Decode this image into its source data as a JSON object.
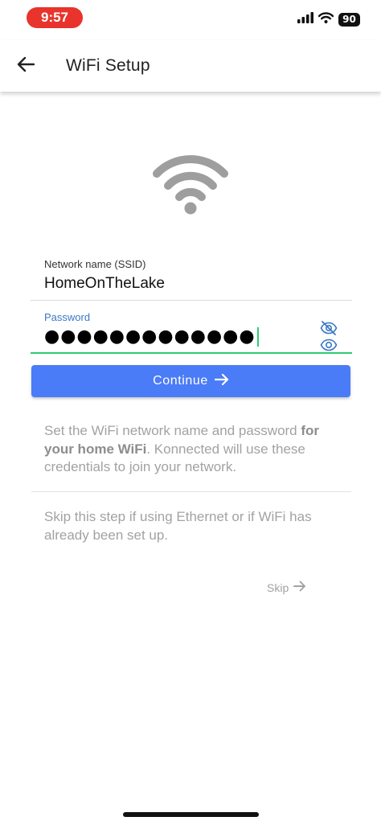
{
  "status_bar": {
    "time": "9:57",
    "battery": "90",
    "icons": [
      "cellular-signal-icon",
      "wifi-status-icon",
      "battery-icon"
    ],
    "time_pill_color": "#e8342c"
  },
  "app_bar": {
    "title": "WiFi Setup",
    "back_icon": "arrow-left-icon"
  },
  "hero_icon": "wifi-icon",
  "form": {
    "ssid": {
      "label": "Network name (SSID)",
      "value": "HomeOnTheLake"
    },
    "password": {
      "label": "Password",
      "masked_value": "●●●●●●●●●●●●●",
      "toggle_icons": [
        "eye-off-icon",
        "eye-icon"
      ],
      "focus_color": "#2ecc71"
    }
  },
  "continue_button": {
    "label": "Continue",
    "icon": "arrow-right-icon",
    "color": "#4a7cf7"
  },
  "description": {
    "part1": "Set the WiFi network name and password ",
    "bold": "for your home WiFi",
    "part2": ". Konnected will use these credentials to join your network."
  },
  "skip_note": "Skip this step if using Ethernet or if WiFi has already been set up.",
  "skip_link": {
    "label": "Skip",
    "icon": "arrow-right-icon"
  }
}
